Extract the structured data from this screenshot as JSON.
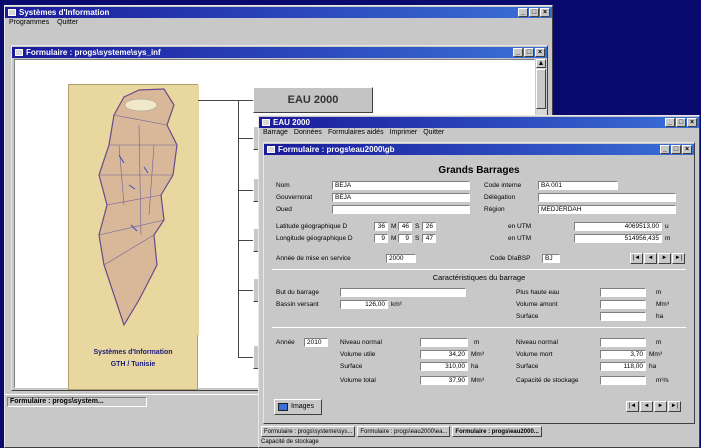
{
  "main_window": {
    "title": "Systèmes d'Information",
    "menu": [
      "Programmes",
      "Quitter"
    ]
  },
  "formulaire1": {
    "title": "Formulaire : progs\\systeme\\sys_inf",
    "map_caption": [
      "Systèmes d'Information",
      "GTH / Tunisie"
    ],
    "eau_button": "EAU 2000"
  },
  "status_main": "Formulaire : progs\\system...",
  "eau_window": {
    "title": "EAU 2000",
    "menu": [
      "Barrage",
      "Données",
      "Formulaires aidés",
      "Imprimer",
      "Quitter"
    ],
    "form_title": "Formulaire : progs\\eau2000\\gb",
    "heading": "Grands Barrages",
    "fields": {
      "nom_label": "Nom",
      "nom_value": "BEJA",
      "gouvernorat_label": "Gouvernorat",
      "gouvernorat_value": "BEJA",
      "oued_label": "Oued",
      "oued_value": "",
      "code_interne_label": "Code interne",
      "code_interne_value": "BA 001",
      "delegation_label": "Délégation",
      "delegation_value": "",
      "region_label": "Région",
      "region_value": "MEDJERDAH",
      "latitude_label": "Latitude    géographique  D",
      "lat_d": "36",
      "lat_m": "46",
      "lat_s": "26",
      "longitude_label": "Longitude  géographique  D",
      "lon_d": "9",
      "lon_m": "9",
      "lon_s": "47",
      "utm_label": "en UTM",
      "utm1": "4069513,00",
      "utm1_unit": "u",
      "utm2": "514956,435",
      "utm2_unit": "m",
      "annee_label": "Année de mise en service",
      "annee_value": "2000",
      "code_dgrebsp_label": "Code DIaBSP",
      "code_dgrebsp_value": "BJ",
      "m_label": "M",
      "s_label": "S"
    },
    "caracteristiques": "Caractéristiques du barrage",
    "char_fields": {
      "but_label": "But du barrage",
      "but_value": "",
      "bassin_label": "Bassin versant",
      "bassin_value": "126,00",
      "bassin_unit": "km²",
      "plus_haute_label": "Plus haute eau",
      "plus_haute_unit": "m",
      "volume_amont_label": "Volume amont",
      "volume_amont_unit": "Mm³",
      "surface1_label": "Surface",
      "surface1_unit": "ha",
      "annee_label": "Année",
      "annee_value": "2010",
      "niveau_normal_label": "Niveau normal",
      "niveau_normal_unit": "m",
      "volume_utile_label": "Volume utile",
      "volume_utile_value": "34,20",
      "volume_utile_unit": "Mm³",
      "surface2_label": "Surface",
      "surface2_value": "310,00",
      "surface2_unit": "ha",
      "volume_total_label": "Volume total",
      "volume_total_value": "37,90",
      "volume_total_unit": "Mm³",
      "niveau_normal2_label": "Niveau normal",
      "niveau_normal2_unit": "m",
      "volume_mort_label": "Volume mort",
      "volume_mort_value": "3,70",
      "volume_mort_unit": "Mm³",
      "surface3_label": "Surface",
      "surface3_value": "118,00",
      "surface3_unit": "ha",
      "capacite_label": "Capacité de stockage",
      "capacite_unit": "m³/s"
    },
    "images_button": "Images",
    "taskbar": [
      "Formulaire : progs\\systeme\\sys...",
      "Formulaire : progs\\eau2000\\ea...",
      "Formulaire : progs\\eau2000..."
    ],
    "status": "Capacité de stockage"
  },
  "nav_glyphs": {
    "first": "|◄",
    "prev": "◄",
    "next": "►",
    "last": "►|",
    "min": "_",
    "max": "□",
    "close": "×"
  },
  "colors": {
    "title_active": "#1a1a9a",
    "desktop": "#0a0a6e",
    "window": "#c8c8c8"
  }
}
